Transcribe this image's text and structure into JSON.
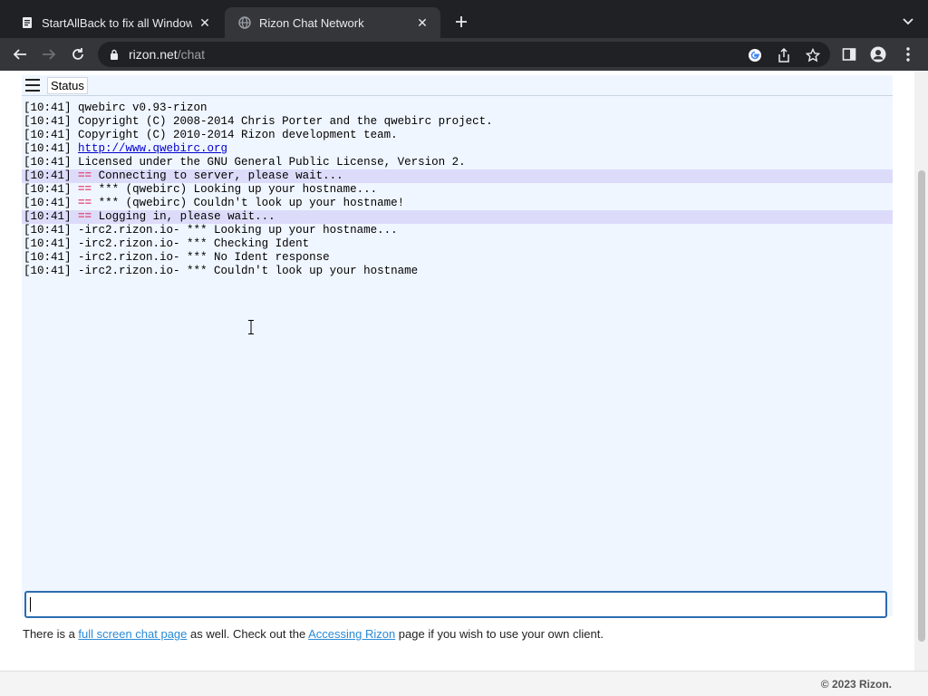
{
  "browser": {
    "tabs": [
      {
        "title": "StartAllBack to fix all Windows",
        "active": false,
        "favicon": "document-icon"
      },
      {
        "title": "Rizon Chat Network",
        "active": true,
        "favicon": "globe-icon"
      }
    ],
    "address": {
      "host": "rizon.net",
      "path": "/chat"
    }
  },
  "chat": {
    "window_tab_label": "Status",
    "lines": [
      {
        "time": "[10:41]",
        "marker": "",
        "text": "qwebirc v0.93-rizon",
        "highlight": false,
        "link": false
      },
      {
        "time": "[10:41]",
        "marker": "",
        "text": "Copyright (C) 2008-2014 Chris Porter and the qwebirc project.",
        "highlight": false,
        "link": false
      },
      {
        "time": "[10:41]",
        "marker": "",
        "text": "Copyright (C) 2010-2014 Rizon development team.",
        "highlight": false,
        "link": false
      },
      {
        "time": "[10:41]",
        "marker": "",
        "text": "http://www.qwebirc.org",
        "highlight": false,
        "link": true
      },
      {
        "time": "[10:41]",
        "marker": "",
        "text": "Licensed under the GNU General Public License, Version 2.",
        "highlight": false,
        "link": false
      },
      {
        "time": "[10:41]",
        "marker": "==",
        "text": "Connecting to server, please wait...",
        "highlight": true,
        "link": false
      },
      {
        "time": "[10:41]",
        "marker": "==",
        "text": "*** (qwebirc) Looking up your hostname...",
        "highlight": false,
        "link": false
      },
      {
        "time": "[10:41]",
        "marker": "==",
        "text": "*** (qwebirc) Couldn't look up your hostname!",
        "highlight": false,
        "link": false
      },
      {
        "time": "[10:41]",
        "marker": "==",
        "text": "Logging in, please wait...",
        "highlight": true,
        "link": false
      },
      {
        "time": "[10:41]",
        "marker": "",
        "text": "-irc2.rizon.io- *** Looking up your hostname...",
        "highlight": false,
        "link": false
      },
      {
        "time": "[10:41]",
        "marker": "",
        "text": "-irc2.rizon.io- *** Checking Ident",
        "highlight": false,
        "link": false
      },
      {
        "time": "[10:41]",
        "marker": "",
        "text": "-irc2.rizon.io- *** No Ident response",
        "highlight": false,
        "link": false
      },
      {
        "time": "[10:41]",
        "marker": "",
        "text": "-irc2.rizon.io- *** Couldn't look up your hostname",
        "highlight": false,
        "link": false
      }
    ],
    "input_value": ""
  },
  "footnote": {
    "part1": "There is a ",
    "link1": "full screen chat page",
    "part2": " as well. Check out the ",
    "link2": "Accessing Rizon",
    "part3": " page if you wish to use your own client."
  },
  "footer": {
    "copyright": "© 2023 Rizon."
  },
  "colors": {
    "accent": "#2b6cb0",
    "highlight_row": "#dcdcfa",
    "marker": "#e75480",
    "link": "#2a8ad6"
  }
}
